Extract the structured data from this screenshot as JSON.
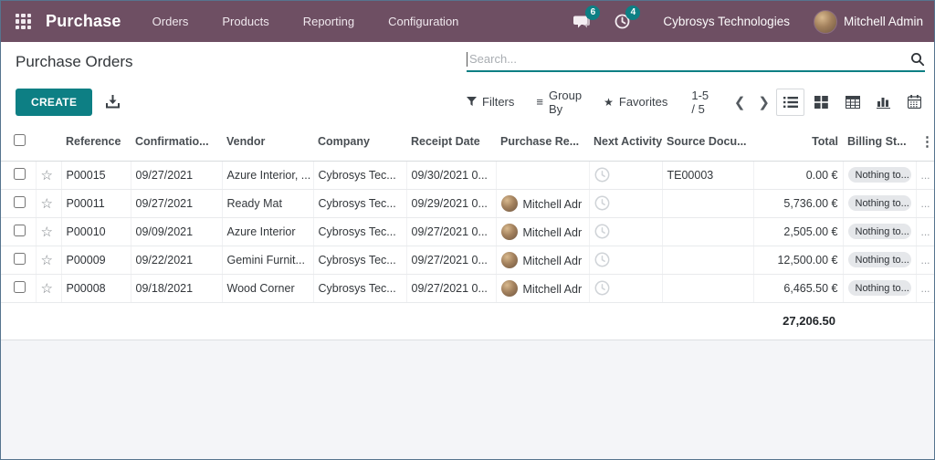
{
  "topbar": {
    "app_name": "Purchase",
    "menus": [
      {
        "label": "Orders"
      },
      {
        "label": "Products"
      },
      {
        "label": "Reporting"
      },
      {
        "label": "Configuration"
      }
    ],
    "messages_badge": "6",
    "activities_badge": "4",
    "company_name": "Cybrosys Technologies",
    "user_name": "Mitchell Admin"
  },
  "control_panel": {
    "title": "Purchase Orders",
    "search_placeholder": "Search...",
    "create_label": "CREATE",
    "filters_label": "Filters",
    "group_by_label": "Group By",
    "favorites_label": "Favorites",
    "pager": "1-5 / 5"
  },
  "icons": {
    "star_outline": "☆",
    "favorite_star": "★",
    "group_by_lines": "≡",
    "kebab": "⋮",
    "prev_chevron": "❮",
    "next_chevron": "❯"
  },
  "table": {
    "headers": {
      "reference": "Reference",
      "confirmation_date": "Confirmatio...",
      "vendor": "Vendor",
      "company": "Company",
      "receipt_date": "Receipt Date",
      "purchase_rep": "Purchase Re...",
      "next_activity": "Next Activity",
      "source_document": "Source Docu...",
      "total": "Total",
      "billing_status": "Billing St..."
    },
    "rows": [
      {
        "reference": "P00015",
        "confirmation_date": "09/27/2021",
        "vendor": "Azure Interior, ...",
        "company": "Cybrosys Tec...",
        "receipt_date": "09/30/2021 0...",
        "purchase_rep": "",
        "source_document": "TE00003",
        "total": "0.00 €",
        "billing_status": "Nothing to...",
        "overflow": "..."
      },
      {
        "reference": "P00011",
        "confirmation_date": "09/27/2021",
        "vendor": "Ready Mat",
        "company": "Cybrosys Tec...",
        "receipt_date": "09/29/2021 0...",
        "purchase_rep": "Mitchell Adr",
        "source_document": "",
        "total": "5,736.00 €",
        "billing_status": "Nothing to...",
        "overflow": "..."
      },
      {
        "reference": "P00010",
        "confirmation_date": "09/09/2021",
        "vendor": "Azure Interior",
        "company": "Cybrosys Tec...",
        "receipt_date": "09/27/2021 0...",
        "purchase_rep": "Mitchell Adr",
        "source_document": "",
        "total": "2,505.00 €",
        "billing_status": "Nothing to...",
        "overflow": "..."
      },
      {
        "reference": "P00009",
        "confirmation_date": "09/22/2021",
        "vendor": "Gemini Furnit...",
        "company": "Cybrosys Tec...",
        "receipt_date": "09/27/2021 0...",
        "purchase_rep": "Mitchell Adr",
        "source_document": "",
        "total": "12,500.00 €",
        "billing_status": "Nothing to...",
        "overflow": "..."
      },
      {
        "reference": "P00008",
        "confirmation_date": "09/18/2021",
        "vendor": "Wood Corner",
        "company": "Cybrosys Tec...",
        "receipt_date": "09/27/2021 0...",
        "purchase_rep": "Mitchell Adr",
        "source_document": "",
        "total": "6,465.50 €",
        "billing_status": "Nothing to...",
        "overflow": "..."
      }
    ],
    "total_sum": "27,206.50"
  },
  "colors": {
    "topbar_bg": "#6e4f63",
    "accent_teal": "#0d7f84",
    "pill_bg": "#e5e7ea",
    "footer_bg": "#f4f5f8"
  }
}
